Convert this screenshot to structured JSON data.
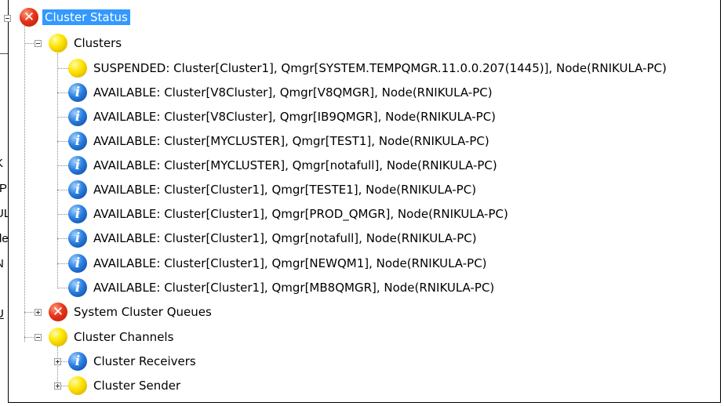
{
  "background_window": {
    "fragments": [
      "K",
      "-P",
      "UL",
      "de",
      "N",
      "U"
    ]
  },
  "tree": {
    "root": {
      "label": "Cluster Status",
      "icon": "error-icon"
    },
    "clusters": {
      "label": "Clusters",
      "icon": "warning-icon",
      "items": [
        {
          "text": "SUSPENDED: Cluster[Cluster1], Qmgr[SYSTEM.TEMPQMGR.11.0.0.207(1445)], Node(RNIKULA-PC)",
          "icon": "warning-icon"
        },
        {
          "text": "AVAILABLE: Cluster[V8Cluster], Qmgr[V8QMGR], Node(RNIKULA-PC)",
          "icon": "info-icon"
        },
        {
          "text": "AVAILABLE: Cluster[V8Cluster], Qmgr[IB9QMGR], Node(RNIKULA-PC)",
          "icon": "info-icon"
        },
        {
          "text": "AVAILABLE: Cluster[MYCLUSTER], Qmgr[TEST1], Node(RNIKULA-PC)",
          "icon": "info-icon"
        },
        {
          "text": "AVAILABLE: Cluster[MYCLUSTER], Qmgr[notafull], Node(RNIKULA-PC)",
          "icon": "info-icon"
        },
        {
          "text": "AVAILABLE: Cluster[Cluster1], Qmgr[TESTE1], Node(RNIKULA-PC)",
          "icon": "info-icon"
        },
        {
          "text": "AVAILABLE: Cluster[Cluster1], Qmgr[PROD_QMGR], Node(RNIKULA-PC)",
          "icon": "info-icon"
        },
        {
          "text": "AVAILABLE: Cluster[Cluster1], Qmgr[notafull], Node(RNIKULA-PC)",
          "icon": "info-icon"
        },
        {
          "text": "AVAILABLE: Cluster[Cluster1], Qmgr[NEWQM1], Node(RNIKULA-PC)",
          "icon": "info-icon"
        },
        {
          "text": "AVAILABLE: Cluster[Cluster1], Qmgr[MB8QMGR], Node(RNIKULA-PC)",
          "icon": "info-icon"
        }
      ]
    },
    "system_cluster_queues": {
      "label": "System Cluster Queues",
      "icon": "error-icon"
    },
    "cluster_channels": {
      "label": "Cluster Channels",
      "icon": "warning-icon",
      "items": [
        {
          "text": "Cluster Receivers",
          "icon": "info-icon"
        },
        {
          "text": "Cluster Sender",
          "icon": "warning-icon"
        }
      ]
    }
  },
  "glyphs": {
    "error": "✕",
    "info": "i"
  },
  "colors": {
    "selection": "#3399ff",
    "error": "#e8331a",
    "warning": "#ffe600",
    "info": "#2a7fe0"
  }
}
